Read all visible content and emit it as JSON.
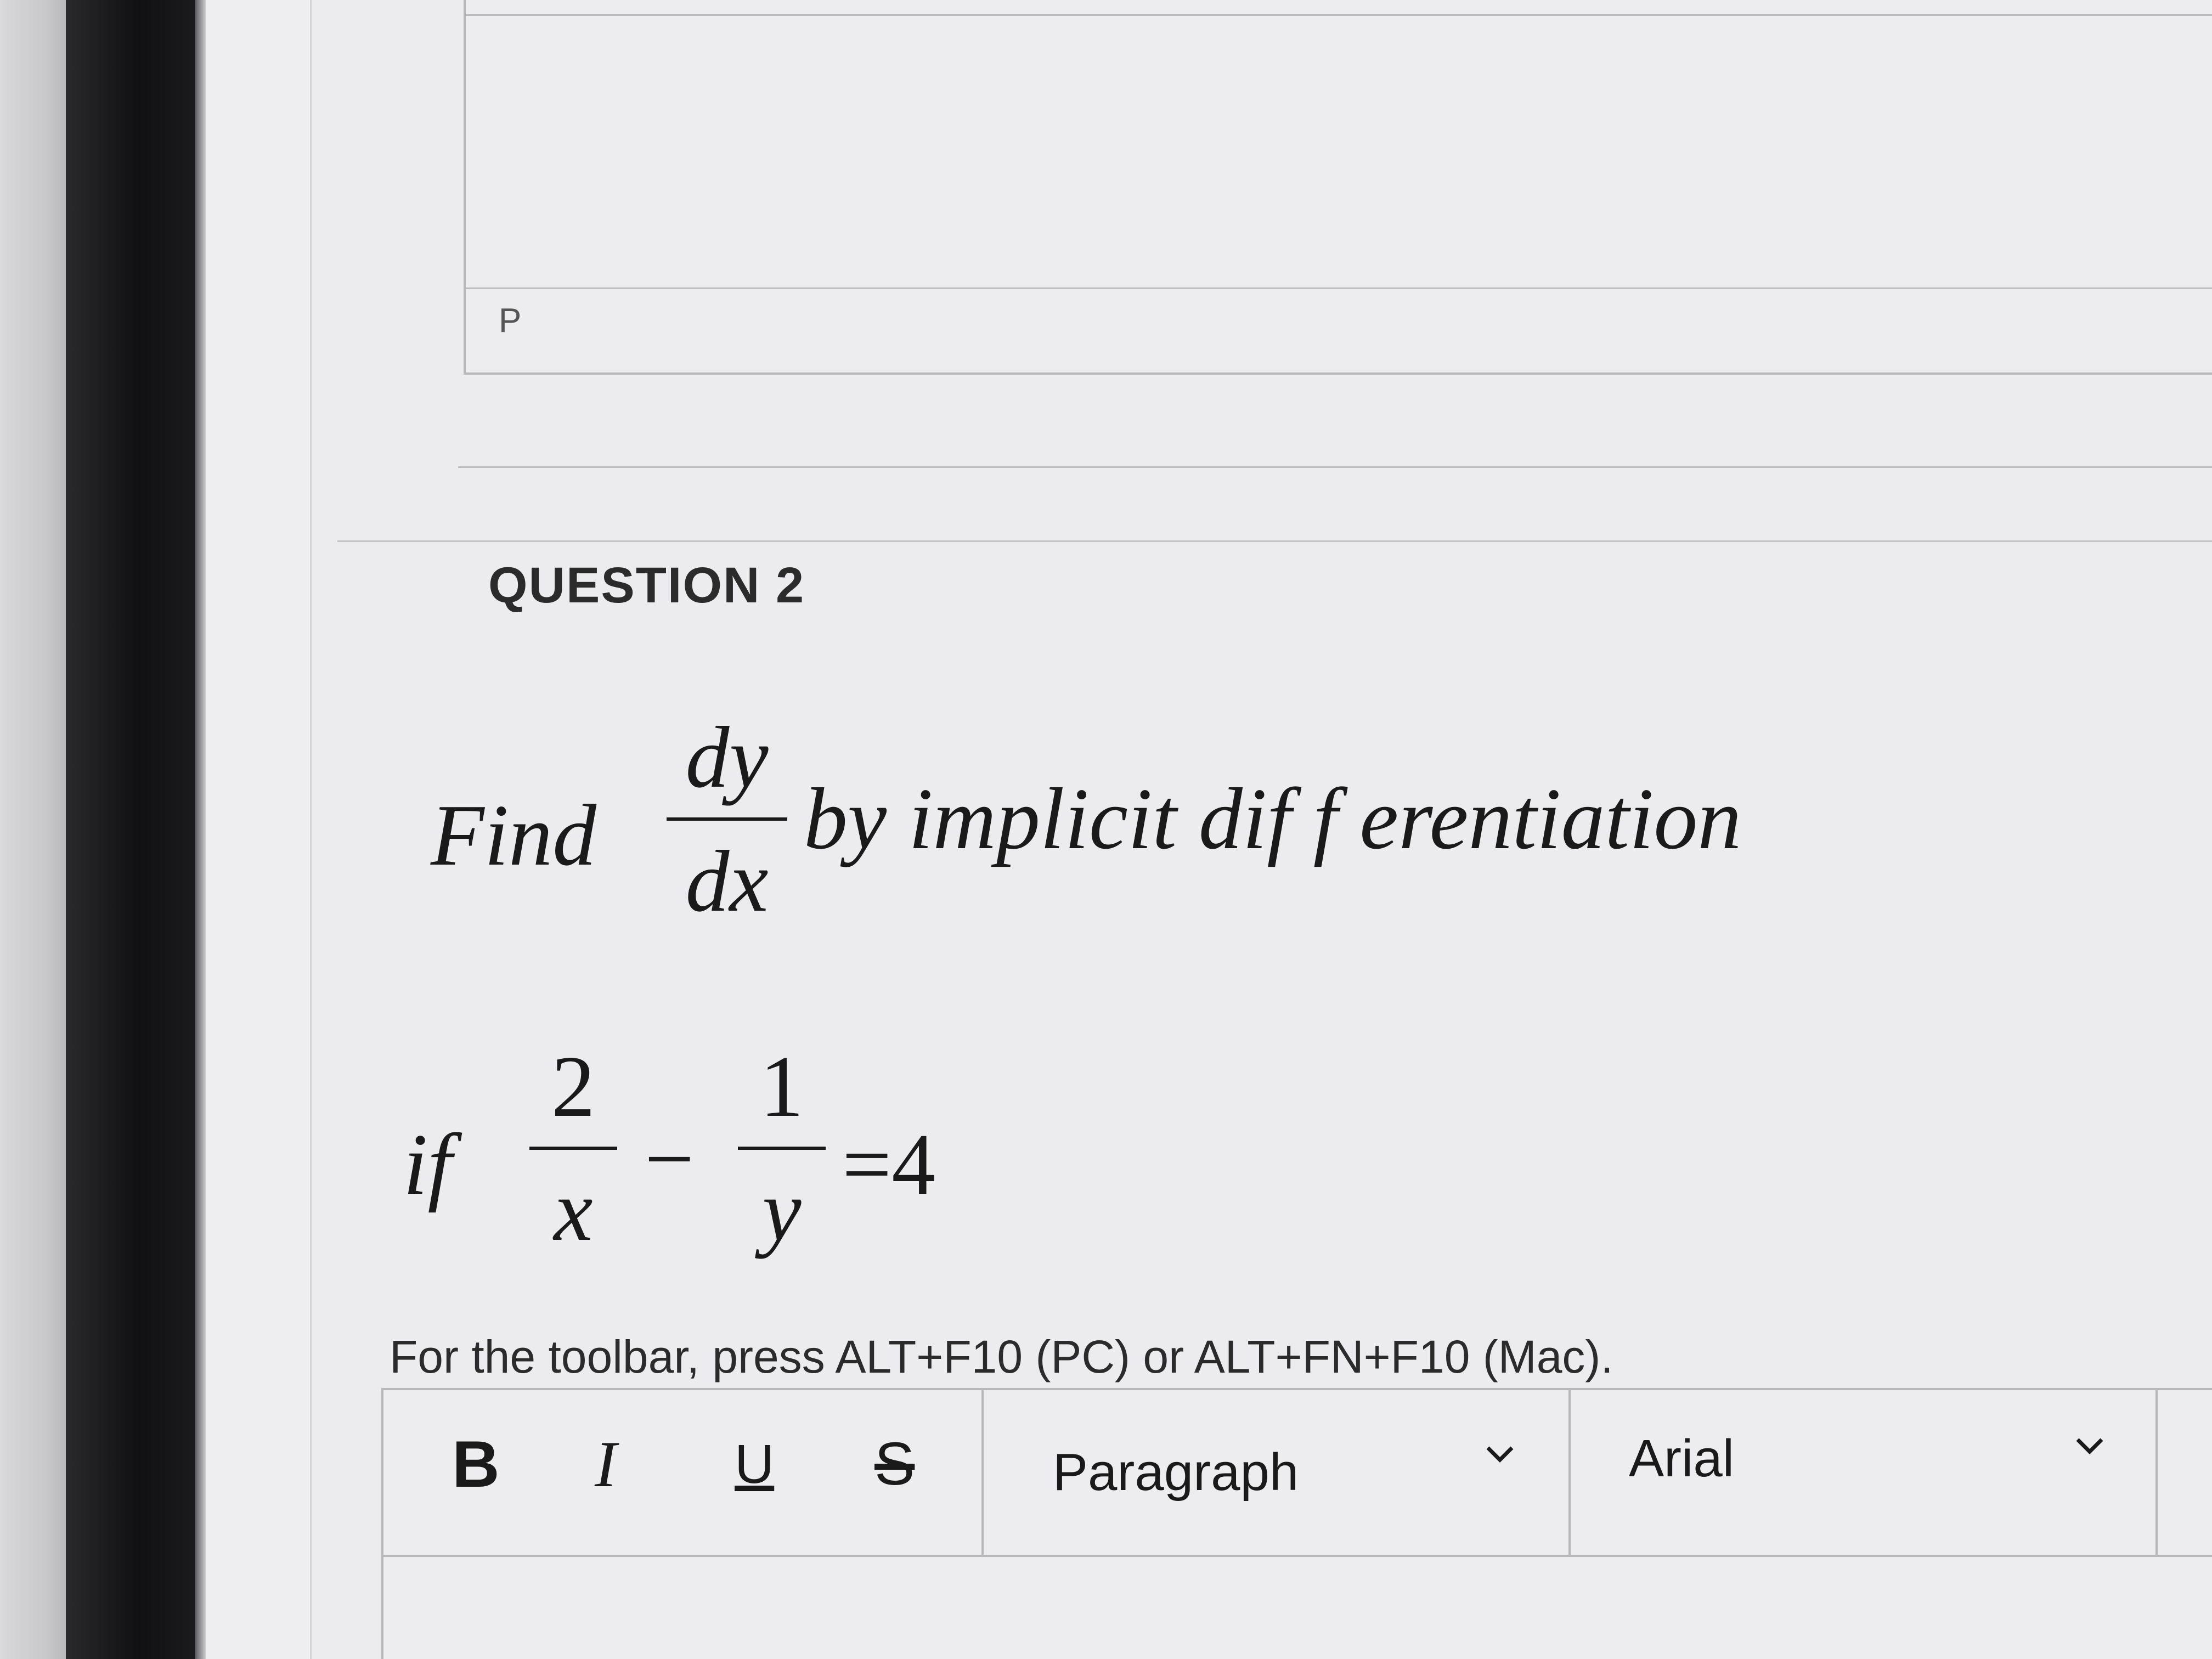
{
  "previous_question": {
    "path_indicator": "P"
  },
  "question": {
    "heading": "QUESTION 2",
    "line1": {
      "find": "Find",
      "fraction_num": "dy",
      "fraction_den": "dx",
      "rest": "by implicit dif f erentiation"
    },
    "line2": {
      "if": "if",
      "term1_num": "2",
      "term1_den": "x",
      "minus": "−",
      "term2_num": "1",
      "term2_den": "y",
      "equals": "=4"
    }
  },
  "editor": {
    "toolbar_hint": "For the toolbar, press ALT+F10 (PC) or ALT+FN+F10 (Mac).",
    "buttons": {
      "bold": "B",
      "italic": "I",
      "underline": "U",
      "strikethrough": "S"
    },
    "paragraph_select": "Paragraph",
    "font_select": "Arial"
  }
}
